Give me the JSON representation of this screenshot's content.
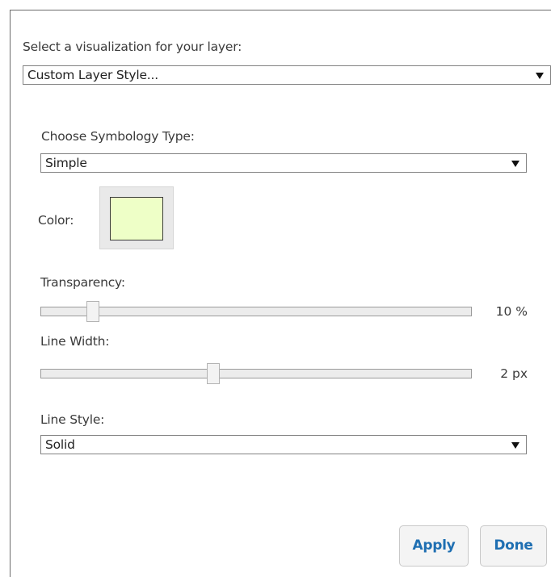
{
  "visualization": {
    "label": "Select a visualization for your layer:",
    "selected": "Custom Layer Style..."
  },
  "symbology": {
    "label": "Choose Symbology Type:",
    "selected": "Simple"
  },
  "color": {
    "label": "Color:",
    "value": "#eeffc7"
  },
  "transparency": {
    "label": "Transparency:",
    "value_text": "10 %",
    "fraction": 0.12
  },
  "line_width": {
    "label": "Line Width:",
    "value_text": "2 px",
    "fraction": 0.4
  },
  "line_style": {
    "label": "Line Style:",
    "selected": "Solid"
  },
  "buttons": {
    "apply": "Apply",
    "done": "Done"
  }
}
